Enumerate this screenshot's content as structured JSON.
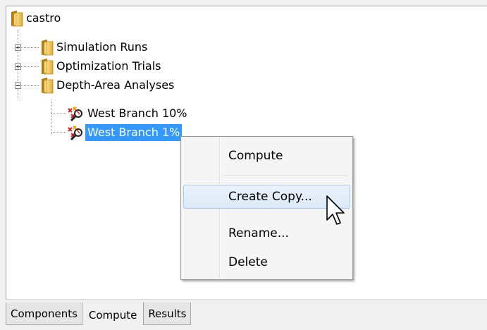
{
  "tree": {
    "root": {
      "label": "castro"
    },
    "folders": [
      {
        "label": "Simulation Runs",
        "expander": "+"
      },
      {
        "label": "Optimization Trials",
        "expander": "+"
      },
      {
        "label": "Depth-Area Analyses",
        "expander": "-"
      }
    ],
    "analyses": [
      {
        "label": "West Branch 10%",
        "selected": false
      },
      {
        "label": "West Branch 1%",
        "selected": true
      }
    ]
  },
  "context_menu": {
    "items": [
      {
        "label": "Compute"
      },
      {
        "label": "Create Copy..."
      },
      {
        "label": "Rename..."
      },
      {
        "label": "Delete"
      }
    ],
    "hovered": "Create Copy..."
  },
  "tabs": [
    {
      "label": "Components",
      "active": false
    },
    {
      "label": "Compute",
      "active": true
    },
    {
      "label": "Results",
      "active": false
    }
  ],
  "colors": {
    "selection": "#3399ff",
    "folder": "#e8b84a",
    "menu_hover_border": "#a8c8ec"
  },
  "icons": {
    "folder": "folder-icon",
    "analysis": "depth-area-analysis-icon",
    "cursor": "mouse-pointer-icon"
  }
}
